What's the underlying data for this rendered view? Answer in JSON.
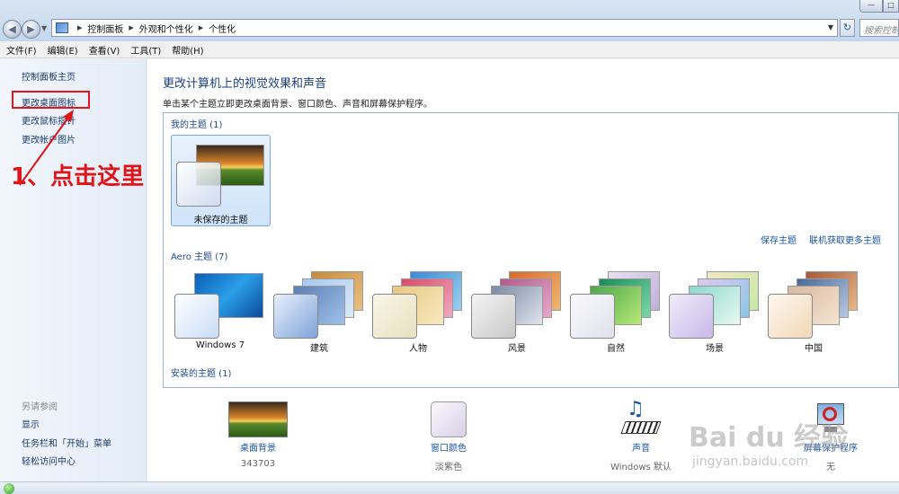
{
  "window": {
    "address": {
      "crumbs": [
        "控制面板",
        "外观和个性化",
        "个性化"
      ]
    },
    "search_placeholder": "搜索控制面板"
  },
  "menu": [
    "文件(F)",
    "编辑(E)",
    "查看(V)",
    "工具(T)",
    "帮助(H)"
  ],
  "sidebar": {
    "links": [
      "控制面板主页",
      "更改桌面图标",
      "更改鼠标指针",
      "更改帐户图片"
    ],
    "see_also_label": "另请参阅",
    "see_also": [
      "显示",
      "任务栏和「开始」菜单",
      "轻松访问中心"
    ]
  },
  "annotation": {
    "text": "1、点击这里",
    "color": "#e01418"
  },
  "main": {
    "title": "更改计算机上的视觉效果和声音",
    "subtitle": "单击某个主题立即更改桌面背景、窗口颜色、声音和屏幕保护程序。",
    "my_themes_label": "我的主题 (1)",
    "my_themes": [
      {
        "name": "未保存的主题"
      }
    ],
    "save_theme": "保存主题",
    "get_more_themes": "联机获取更多主题",
    "aero_label": "Aero 主题 (7)",
    "aero_themes": [
      {
        "name": "Windows 7",
        "swatch": "#c8dcf4"
      },
      {
        "name": "建筑",
        "swatch": "#7fa3d8"
      },
      {
        "name": "人物",
        "swatch": "#e8e0c0"
      },
      {
        "name": "风景",
        "swatch": "#d8d8d8"
      },
      {
        "name": "自然",
        "swatch": "#e8e8f0"
      },
      {
        "name": "场景",
        "swatch": "#c8b8e8"
      },
      {
        "name": "中国",
        "swatch": "#f2d8b8"
      }
    ],
    "installed_label": "安装的主题 (1)"
  },
  "bottom": [
    {
      "label": "桌面背景",
      "value": "343703",
      "icon": "desktop-background-icon"
    },
    {
      "label": "窗口颜色",
      "value": "淡紫色",
      "icon": "window-color-icon"
    },
    {
      "label": "声音",
      "value": "Windows 默认",
      "icon": "sound-icon"
    },
    {
      "label": "屏幕保护程序",
      "value": "无",
      "icon": "screensaver-icon"
    }
  ],
  "watermark": {
    "text": "Bai du 经验",
    "url": "jingyan.baidu.com"
  }
}
